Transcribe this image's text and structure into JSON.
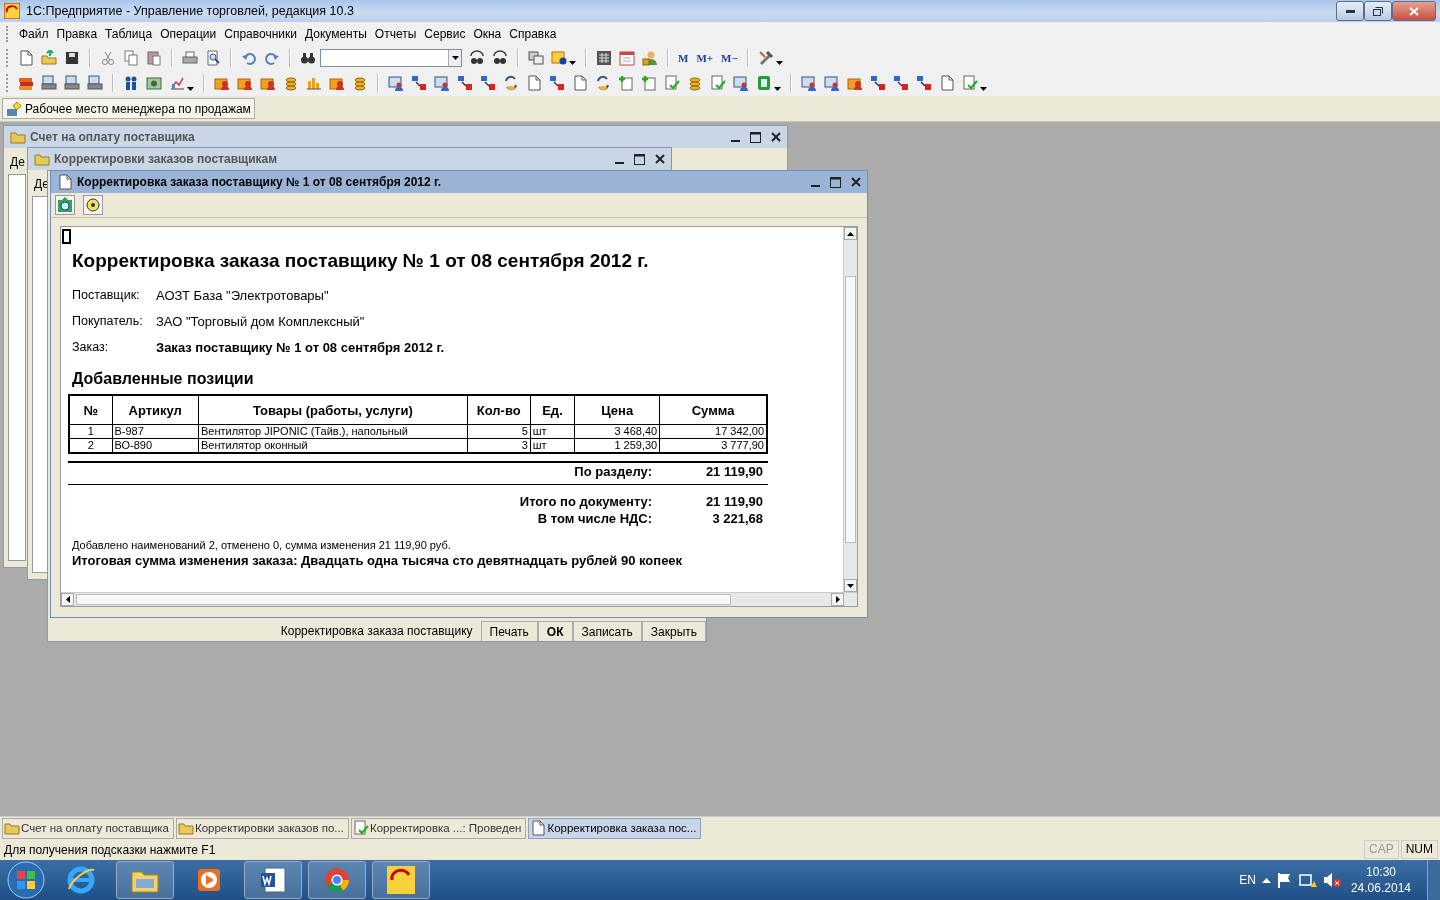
{
  "app_window": {
    "title": "1С:Предприятие - Управление торговлей, редакция 10.3"
  },
  "menu": [
    "Файл",
    "Правка",
    "Таблица",
    "Операции",
    "Справочники",
    "Документы",
    "Отчеты",
    "Сервис",
    "Окна",
    "Справка"
  ],
  "toolbar": {
    "memory_buttons": [
      "M",
      "M+",
      "M−"
    ]
  },
  "panel": {
    "buttons": [
      "Рабочее место менеджера по продажам"
    ]
  },
  "windows": [
    {
      "title": "Счет на оплату поставщика",
      "active": false,
      "text": "Де"
    },
    {
      "title": "Корректировки заказов поставщикам",
      "active": false,
      "text": "Де"
    }
  ],
  "hidden_form": {
    "buttons": [
      {
        "label": "Корректировка заказа поставщику",
        "default": false
      },
      {
        "label": "Печать",
        "default": false
      },
      {
        "label": "ОК",
        "default": true
      },
      {
        "label": "Записать",
        "default": false
      },
      {
        "label": "Закрыть",
        "default": false
      }
    ]
  },
  "active_window": {
    "title": "Корректировка заказа поставщику № 1 от 08 сентября 2012 г.",
    "active": true,
    "document": {
      "title": "Корректировка заказа поставщику № 1 от 08 сентября 2012 г.",
      "fields": [
        {
          "label": "Поставщик:",
          "value": "АОЗТ База \"Электротовары\"",
          "bold": false
        },
        {
          "label": "Покупатель:",
          "value": "ЗАО \"Торговый дом Комплексный\"",
          "bold": false
        },
        {
          "label": "Заказ:",
          "value": "Заказ поставщику № 1 от 08 сентября 2012 г.",
          "bold": true
        }
      ],
      "section_title": "Добавленные позиции",
      "table": {
        "columns": [
          "№",
          "Артикул",
          "Товары (работы, услуги)",
          "Кол-во",
          "Ед.",
          "Цена",
          "Сумма"
        ],
        "rows": [
          [
            "1",
            "В-987",
            "Вентилятор JIPONIC (Тайв.), напольный",
            "5",
            "шт",
            "3 468,40",
            "17 342,00"
          ],
          [
            "2",
            "ВО-890",
            "Вентилятор оконный",
            "3",
            "шт",
            "1 259,30",
            "3 777,90"
          ]
        ]
      },
      "section_total": {
        "label": "По разделу:",
        "value": "21 119,90"
      },
      "totals": [
        {
          "label": "Итого по документу:",
          "value": "21 119,90"
        },
        {
          "label": "В том числе НДС:",
          "value": "3 221,68"
        }
      ],
      "note": "Добавлено наименований 2, отменено 0, сумма изменения 21 119,90 руб.",
      "summary": "Итоговая сумма изменения заказа: Двадцать одна тысяча сто девятнадцать рублей 90 копеек"
    }
  },
  "window_tabs": [
    {
      "label": "Счет на оплату поставщика",
      "selected": false
    },
    {
      "label": "Корректировки заказов по...",
      "selected": false
    },
    {
      "label": "Корректировка ...: Проведен",
      "selected": false
    },
    {
      "label": "Корректировка заказа пос...",
      "selected": true
    }
  ],
  "status_bar": {
    "hint": "Для получения подсказки нажмите F1",
    "indicators": [
      {
        "label": "CAP",
        "on": false
      },
      {
        "label": "NUM",
        "on": true
      }
    ]
  },
  "taskbar": {
    "language": "EN",
    "time": "10:30",
    "date": "24.06.2014"
  }
}
